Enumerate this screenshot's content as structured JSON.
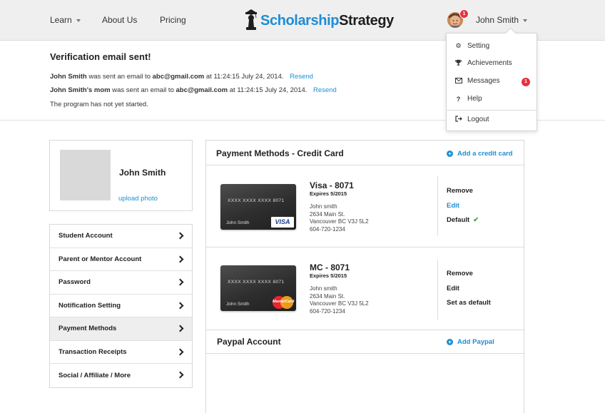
{
  "header": {
    "nav": [
      {
        "label": "Learn"
      },
      {
        "label": "About Us"
      },
      {
        "label": "Pricing"
      }
    ],
    "logo": {
      "part1": "Scholarship",
      "part2": "Strategy"
    },
    "user": {
      "name": "John Smith",
      "badge": "1"
    }
  },
  "dropdown": {
    "items": [
      {
        "label": "Setting",
        "icon": "gear-icon"
      },
      {
        "label": "Achievements",
        "icon": "trophy-icon"
      },
      {
        "label": "Messages",
        "icon": "envelope-icon",
        "badge": "1"
      },
      {
        "label": "Help",
        "icon": "question-icon"
      },
      {
        "label": "Logout",
        "icon": "logout-icon"
      }
    ]
  },
  "notice": {
    "title": "Verification email sent!",
    "line1": {
      "who": "John Smith",
      "mid": " was sent an email to ",
      "email": "abc@gmail.com",
      "tail": " at 11:24:15 July 24, 2014.",
      "link": "Resend"
    },
    "line2": {
      "who": "John Smith's mom",
      "mid": " was sent an email to ",
      "email": "abc@gmail.com",
      "tail": " at 11:24:15 July 24, 2014.",
      "link": "Resend"
    },
    "line3": "The program has not yet started."
  },
  "profile": {
    "name": "John Smith",
    "upload_label": "upload photo"
  },
  "settings_menu": {
    "items": [
      {
        "label": "Student Account"
      },
      {
        "label": "Parent or Mentor Account"
      },
      {
        "label": "Password"
      },
      {
        "label": "Notification Setting"
      },
      {
        "label": "Payment Methods",
        "active": true
      },
      {
        "label": "Transaction Receipts"
      },
      {
        "label": "Social / Affiliate / More"
      }
    ]
  },
  "payment": {
    "title": "Payment Methods - Credit Card",
    "add_card_label": "Add a credit card",
    "cards": [
      {
        "title": "Visa - 8071",
        "expires": "Expires 5/2015",
        "address": [
          "John smith",
          "2634 Main St.",
          "Vancouver BC V3J 5L2",
          "604-720-1234"
        ],
        "card_number": "XXXX  XXXX  XXXX  8071",
        "card_name": "John Smith",
        "brand": "VISA",
        "actions": {
          "remove": "Remove",
          "edit": "Edit",
          "default": "Default"
        }
      },
      {
        "title": "MC - 8071",
        "expires": "Expires 5/2015",
        "address": [
          "John smith",
          "2634 Main St.",
          "Vancouver BC V3J 5L2",
          "604-720-1234"
        ],
        "card_number": "XXXX  XXXX  XXXX  8071",
        "card_name": "John Smith",
        "brand": "MasterCard",
        "actions": {
          "remove": "Remove",
          "edit": "Edit",
          "set_default": "Set as default"
        }
      }
    ],
    "paypal_title": "Paypal Account",
    "add_paypal_label": "Add Paypal"
  },
  "colors": {
    "accent": "#1d8dd6",
    "badge": "#e8303e",
    "check": "#3aa83a"
  }
}
